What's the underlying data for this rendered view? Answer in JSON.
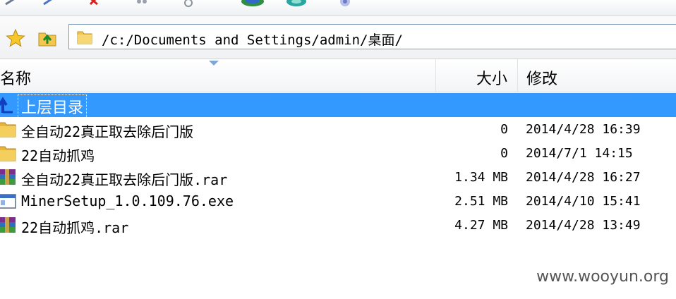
{
  "address": {
    "path": "/c:/Documents and Settings/admin/桌面/"
  },
  "columns": {
    "name": "名称",
    "size": "大小",
    "modified": "修改"
  },
  "rows": [
    {
      "name": "上层目录",
      "size": "",
      "modified": "",
      "icon": "parent-dir-icon"
    },
    {
      "name": "全自动22真正取去除后门版",
      "size": "0",
      "modified": "2014/4/28 16:39",
      "icon": "folder-icon"
    },
    {
      "name": "22自动抓鸡",
      "size": "0",
      "modified": "2014/7/1 14:15",
      "icon": "folder-icon"
    },
    {
      "name": "全自动22真正取去除后门版.rar",
      "size": "1.34 MB",
      "modified": "2014/4/28 16:27",
      "icon": "rar-archive-icon"
    },
    {
      "name": "MinerSetup_1.0.109.76.exe",
      "size": "2.51 MB",
      "modified": "2014/4/10 15:41",
      "icon": "exe-file-icon"
    },
    {
      "name": "22自动抓鸡.rar",
      "size": "4.27 MB",
      "modified": "2014/4/28 13:49",
      "icon": "rar-archive-icon"
    }
  ],
  "watermark": "www.wooyun.org",
  "colors": {
    "selection": "#3399ff",
    "folder": "#f2c64f"
  }
}
